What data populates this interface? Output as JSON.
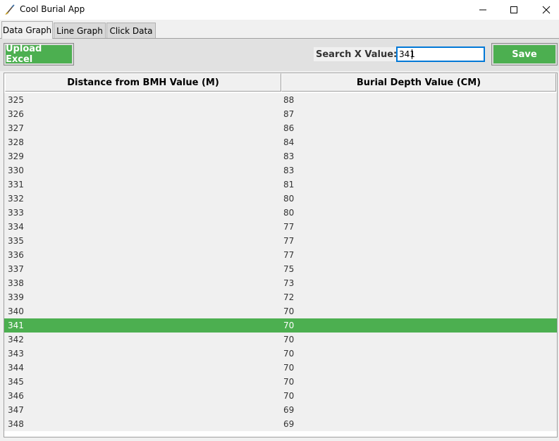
{
  "window": {
    "title": "Cool Burial App",
    "app_icon": "paintbrush-icon"
  },
  "tabs": [
    {
      "label": "Data Graph",
      "active": true
    },
    {
      "label": "Line Graph",
      "active": false
    },
    {
      "label": "Click Data",
      "active": false
    }
  ],
  "toolbar": {
    "upload_label": "Upload Excel",
    "search_label": "Search X Value:",
    "search_value": "341",
    "save_label": "Save"
  },
  "colors": {
    "accent": "#4caf50",
    "focus_border": "#0078d7"
  },
  "table": {
    "columns": [
      "Distance from BMH Value (M)",
      "Burial Depth Value (CM)"
    ],
    "selected_index": 16,
    "rows": [
      [
        "325",
        "88"
      ],
      [
        "326",
        "87"
      ],
      [
        "327",
        "86"
      ],
      [
        "328",
        "84"
      ],
      [
        "329",
        "83"
      ],
      [
        "330",
        "83"
      ],
      [
        "331",
        "81"
      ],
      [
        "332",
        "80"
      ],
      [
        "333",
        "80"
      ],
      [
        "334",
        "77"
      ],
      [
        "335",
        "77"
      ],
      [
        "336",
        "77"
      ],
      [
        "337",
        "75"
      ],
      [
        "338",
        "73"
      ],
      [
        "339",
        "72"
      ],
      [
        "340",
        "70"
      ],
      [
        "341",
        "70"
      ],
      [
        "342",
        "70"
      ],
      [
        "343",
        "70"
      ],
      [
        "344",
        "70"
      ],
      [
        "345",
        "70"
      ],
      [
        "346",
        "70"
      ],
      [
        "347",
        "69"
      ],
      [
        "348",
        "69"
      ]
    ]
  }
}
